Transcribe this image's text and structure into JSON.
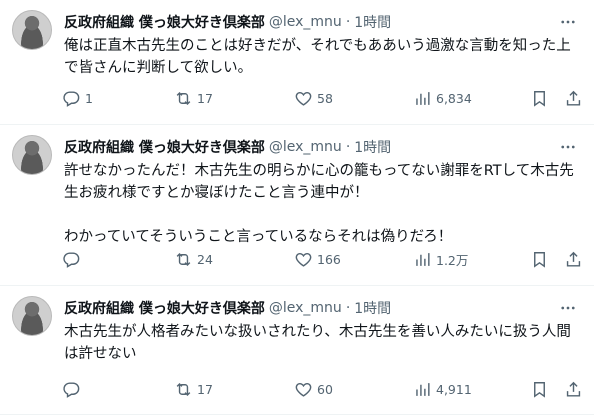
{
  "tweets": [
    {
      "name": "反政府組織 僕っ娘大好き倶楽部",
      "handle": "@lex_mnu",
      "time": "1時間",
      "text": "俺は正直木古先生のことは好きだが、それでもああいう過激な言動を知った上で皆さんに判断して欲しい。",
      "replies": "1",
      "retweets": "17",
      "likes": "58",
      "views": "6,834"
    },
    {
      "name": "反政府組織 僕っ娘大好き倶楽部",
      "handle": "@lex_mnu",
      "time": "1時間",
      "text": "許せなかったんだ！木古先生の明らかに心の籠もってない謝罪をRTして木古先生お疲れ様ですとか寝ぼけたこと言う連中が！\n\nわかっていてそういうこと言っているならそれは偽りだろ！",
      "replies": "",
      "retweets": "24",
      "likes": "166",
      "views": "1.2万"
    },
    {
      "name": "反政府組織 僕っ娘大好き倶楽部",
      "handle": "@lex_mnu",
      "time": "1時間",
      "text": "木古先生が人格者みたいな扱いされたり、木古先生を善い人みたいに扱う人間は許せない",
      "replies": "",
      "retweets": "17",
      "likes": "60",
      "views": "4,911"
    }
  ],
  "icons": {
    "more": "more-icon",
    "reply": "reply-icon",
    "retweet": "retweet-icon",
    "like": "heart-icon",
    "views": "views-icon",
    "bookmark": "bookmark-icon",
    "share": "share-icon"
  },
  "colors": {
    "text": "#0f1419",
    "secondary": "#536471",
    "divider": "#eff3f4"
  }
}
